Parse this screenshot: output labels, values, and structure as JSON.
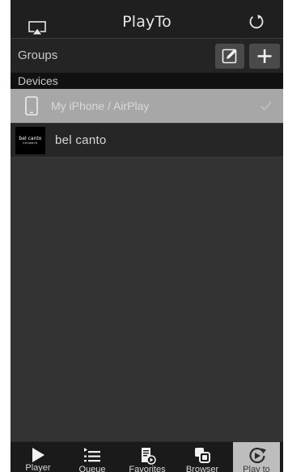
{
  "header": {
    "title": "PlayTo"
  },
  "groups": {
    "label": "Groups"
  },
  "devices": {
    "label": "Devices",
    "items": [
      {
        "name": "My iPhone / AirPlay",
        "selected": true
      },
      {
        "name": "bel  canto",
        "selected": false,
        "logo_line1": "bel canto",
        "logo_line2": "network"
      }
    ]
  },
  "tabs": [
    {
      "label": "Player",
      "icon": "play-icon",
      "active": false
    },
    {
      "label": "Queue",
      "icon": "queue-icon",
      "active": false
    },
    {
      "label": "Favorites",
      "icon": "favorites-icon",
      "active": false
    },
    {
      "label": "Browser",
      "icon": "browser-icon",
      "active": false
    },
    {
      "label": "Play to",
      "icon": "play-to-icon",
      "active": true
    }
  ],
  "colors": {
    "header_bg": "#1f1f1f",
    "content_bg": "#333333",
    "selected_row": "#a7a7a7",
    "active_tab": "#bdbdbd"
  }
}
